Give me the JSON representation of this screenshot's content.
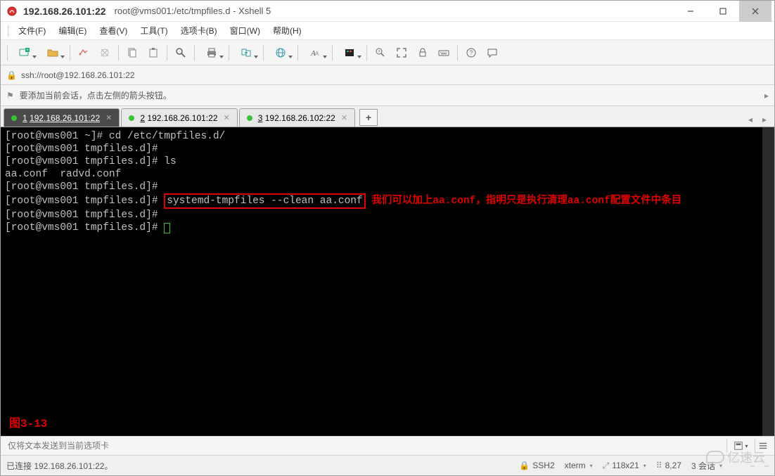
{
  "window": {
    "title_ip": "192.168.26.101:22",
    "title_path": "root@vms001:/etc/tmpfiles.d - Xshell 5"
  },
  "menu": {
    "items": [
      "文件(F)",
      "编辑(E)",
      "查看(V)",
      "工具(T)",
      "选项卡(B)",
      "窗口(W)",
      "帮助(H)"
    ]
  },
  "toolbar_icons": {
    "new_session": "new-session-icon",
    "open": "open-folder-icon",
    "reconnect": "reconnect-icon",
    "disconnect": "disconnect-icon",
    "copy": "copy-icon",
    "paste": "paste-icon",
    "find": "find-icon",
    "print": "print-icon",
    "file_transfer": "file-transfer-icon",
    "globe": "globe-icon",
    "font": "font-icon",
    "color": "color-scheme-icon",
    "zoom": "zoom-icon",
    "fullscreen": "fullscreen-icon",
    "lock": "lock-icon",
    "keyboard": "keyboard-icon",
    "help": "help-icon",
    "feedback": "feedback-icon"
  },
  "addressbar": {
    "url": "ssh://root@192.168.26.101:22"
  },
  "hintbar": {
    "text": "要添加当前会话，点击左侧的箭头按钮。"
  },
  "tabs": [
    {
      "num": "1",
      "label": "192.168.26.101:22",
      "active": true
    },
    {
      "num": "2",
      "label": "192.168.26.101:22",
      "active": false
    },
    {
      "num": "3",
      "label": "192.168.26.102:22",
      "active": false
    }
  ],
  "terminal": {
    "lines": [
      {
        "prompt": "[root@vms001 ~]# ",
        "cmd": "cd /etc/tmpfiles.d/"
      },
      {
        "prompt": "[root@vms001 tmpfiles.d]# ",
        "cmd": ""
      },
      {
        "prompt": "[root@vms001 tmpfiles.d]# ",
        "cmd": "ls"
      },
      {
        "plain": "aa.conf  radvd.conf"
      },
      {
        "prompt": "[root@vms001 tmpfiles.d]# ",
        "cmd": ""
      },
      {
        "prompt": "[root@vms001 tmpfiles.d]# ",
        "highlight": "systemd-tmpfiles --clean aa.conf",
        "annot": " 我们可以加上aa.conf，指明只是执行清理aa.conf配置文件中条目"
      },
      {
        "prompt": "[root@vms001 tmpfiles.d]# ",
        "cmd": ""
      },
      {
        "prompt": "[root@vms001 tmpfiles.d]# ",
        "cursor": true
      }
    ],
    "figure_label": "图3-13"
  },
  "sendbar": {
    "placeholder": "仅将文本发送到当前选项卡"
  },
  "statusbar": {
    "connected": "已连接 192.168.26.101:22。",
    "protocol": "SSH2",
    "term": "xterm",
    "size": "118x21",
    "cursor_pos": "8,27",
    "sessions": "3 会话"
  },
  "watermark": "亿速云"
}
